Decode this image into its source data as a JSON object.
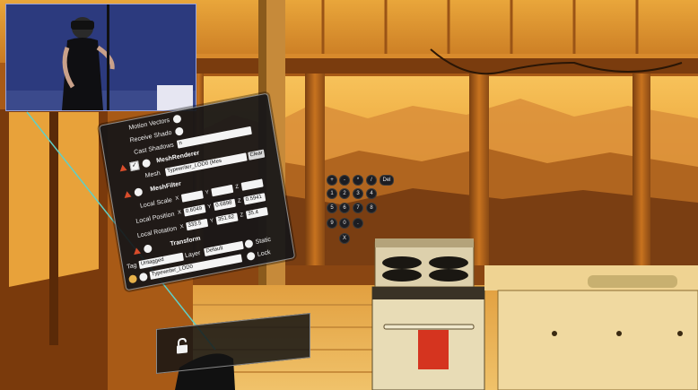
{
  "inspector": {
    "motion_vectors": "Motion Vectors",
    "receive_shadows": "Receive Shado",
    "cast_shadows": "Cast Shadows",
    "cast_shadows_value": "n",
    "mesh_renderer": "MeshRenderer",
    "mesh_label": "Mesh",
    "mesh_value": "Typewriter_LOD0 (Mes",
    "clear_label": "Clear",
    "mesh_filter": "MeshFilter",
    "local_scale": "Local Scale",
    "local_position": "Local Position",
    "local_rotation": "Local Rotation",
    "scale": {
      "x": "",
      "y": "",
      "z": ""
    },
    "position": {
      "x": "0.6049",
      "y": "0.6898",
      "z": "0.5941"
    },
    "rotation": {
      "x": "333.5",
      "y": "351.62",
      "z": "35.4"
    },
    "axis_x": "X",
    "axis_y": "Y",
    "axis_z": "Z",
    "transform": "Transform",
    "tag_label": "Tag",
    "tag_value": "Untagged",
    "layer_label": "Layer",
    "layer_value": "Default",
    "static_label": "Static",
    "lock_label": "Lock",
    "object_name": "Typewriter_LOD0"
  },
  "keypad": {
    "keys": [
      "+",
      "-",
      "*",
      "/",
      "Del",
      "1",
      "2",
      "3",
      "4",
      "5",
      "6",
      "7",
      "8",
      "9",
      "0",
      ".",
      "X"
    ]
  },
  "colors": {
    "panel_bg": "#161618",
    "panel_border": "#8a8a8a",
    "field_bg": "#f4f4f4",
    "component_icon": "#d94d2b",
    "pointer_ray": "#5fd0c8"
  },
  "icons": {
    "lock": "lock-icon",
    "component": "triangle-icon"
  }
}
